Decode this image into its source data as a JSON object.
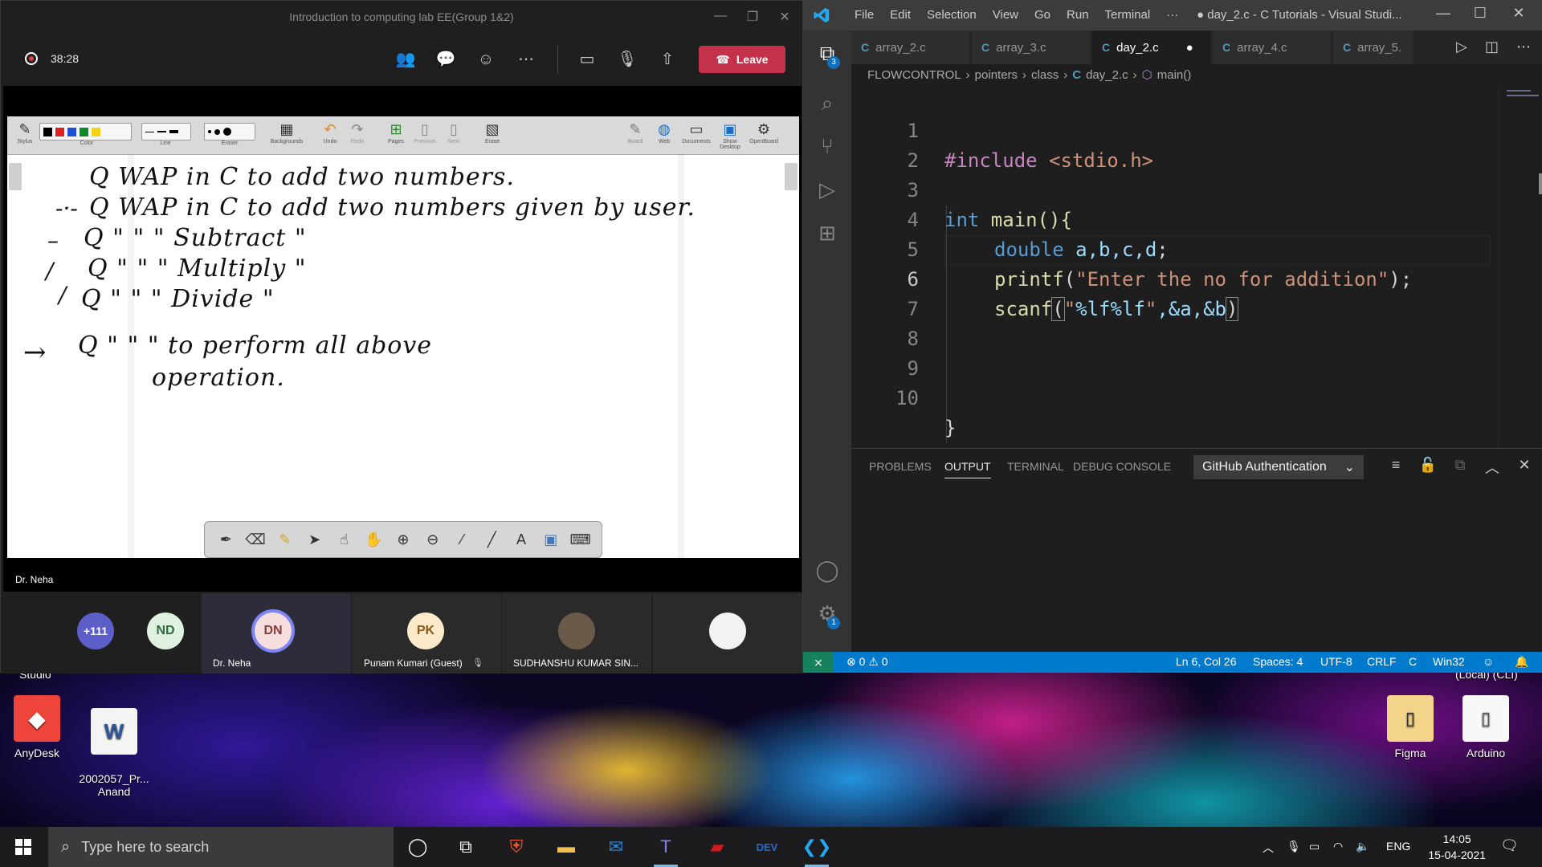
{
  "teams": {
    "title": "Introduction to computing lab EE(Group 1&2)",
    "timer": "38:28",
    "leave_label": "Leave",
    "presenter": "Dr. Neha",
    "openboard_tools": [
      "Stylus",
      "Color",
      "Line",
      "Eraser",
      "Backgrounds",
      "Undo",
      "Redo",
      "Pages",
      "Previous",
      "Next",
      "Erase"
    ],
    "openboard_right_tools": [
      "Board",
      "Web",
      "Documents",
      "Show Desktop",
      "OpenBoard"
    ],
    "whiteboard_lines": [
      "Q  WAP in C  to  add  two  numbers.",
      "Q  WAP in C  to   add  two  numbers  given by  user.",
      "Q  \"   \"   \"   Subtract  \"",
      "Q  \"   \"   \"   Multiply  \"",
      "Q  \"   \"   \"   Divide   \"",
      "Q  \"   \"   \"   to  perform  all  above",
      "operation."
    ],
    "participants": {
      "overflow": "+111",
      "nd_initials": "ND",
      "neha_initials": "DN",
      "neha_name": "Dr. Neha",
      "punam_initials": "PK",
      "punam_name": "Punam Kumari (Guest)",
      "sudhanshu_name": "SUDHANSHU KUMAR SIN..."
    }
  },
  "vscode": {
    "menu": [
      "File",
      "Edit",
      "Selection",
      "View",
      "Go",
      "Run",
      "Terminal",
      "···"
    ],
    "window_title": "● day_2.c - C Tutorials - Visual Studi...",
    "explorer_badge": "3",
    "settings_badge": "1",
    "tabs": [
      "array_2.c",
      "array_3.c",
      "day_2.c",
      "array_4.c",
      "array_5."
    ],
    "active_tab_dirty": "●",
    "breadcrumb": [
      "FLOWCONTROL",
      "pointers",
      "class",
      "day_2.c",
      "main()"
    ],
    "line_numbers": [
      "1",
      "2",
      "3",
      "4",
      "5",
      "6",
      "7",
      "8",
      "9",
      "10"
    ],
    "code": {
      "l1_directive": "#include",
      "l1_header": " <stdio.h>",
      "l3_type": "int",
      "l3_rest": " main(){",
      "l4_type": "double",
      "l4_vars": " a,b,c,d",
      "l4_end": ";",
      "l5_fn": "printf",
      "l5_open": "(",
      "l5_str": "\"Enter the no for addition\"",
      "l5_end": ");",
      "l6_fn": "scanf",
      "l6_open": "(",
      "l6_str_q1": "\"",
      "l6_fmt": "%lf%lf",
      "l6_str_q2": "\"",
      "l6_args": ",&a,&b",
      "l6_close": ")",
      "l10": "}"
    },
    "panel_tabs": [
      "PROBLEMS",
      "OUTPUT",
      "TERMINAL",
      "DEBUG CONSOLE"
    ],
    "output_channel": "GitHub Authentication",
    "status": {
      "problems": "⊗ 0 ⚠ 0",
      "position": "Ln 6, Col 26",
      "spaces": "Spaces: 4",
      "encoding": "UTF-8",
      "eol": "CRLF",
      "language": "C",
      "config": "Win32"
    }
  },
  "desktop": {
    "icons": [
      {
        "label": "AnyDesk"
      },
      {
        "label": "2002057_Pr...\nAnand"
      },
      {
        "label": "Figma"
      },
      {
        "label": "Arduino"
      }
    ],
    "partial_top_left": "Studio",
    "partial_top_right": "(Local) (CLI)"
  },
  "taskbar": {
    "search_placeholder": "Type here to search",
    "language": "ENG",
    "time": "14:05",
    "date": "15-04-2021"
  },
  "colors": {
    "teams_leave": "#c4314b",
    "vscode_status": "#007acc",
    "vscode_accent": "#0e70c0"
  }
}
